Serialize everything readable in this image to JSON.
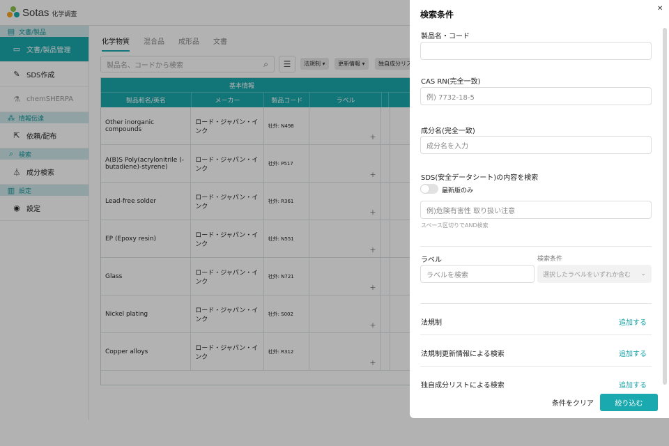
{
  "app": {
    "logo_text": "Sotas",
    "logo_sub": "化学調査",
    "colors": {
      "accent": "#1aa9ae",
      "accent_text": "#15a3a8",
      "section_bg": "#cfe9ea",
      "logo_green": "#8bc34a",
      "logo_orange": "#f5a623",
      "logo_teal": "#1aa9ae"
    }
  },
  "sidebar": {
    "sections": [
      {
        "label": "文書/製品",
        "icon": "document-icon",
        "items": [
          {
            "label": "文書/製品管理",
            "icon": "folder-icon",
            "active": true
          }
        ]
      },
      {
        "label": "",
        "items": [
          {
            "label": "SDS作成",
            "icon": "pencil-icon"
          },
          {
            "label": "chemSHERPA",
            "icon": "flask-icon",
            "disabled": true
          }
        ]
      },
      {
        "label": "情報伝達",
        "icon": "share-icon",
        "items": [
          {
            "label": "依頼/配布",
            "icon": "export-icon"
          }
        ]
      },
      {
        "label": "検索",
        "icon": "search-icon",
        "items": [
          {
            "label": "成分検索",
            "icon": "beaker-icon"
          }
        ]
      },
      {
        "label": "設定",
        "icon": "building-icon",
        "items": [
          {
            "label": "設定",
            "icon": "person-icon"
          }
        ]
      }
    ]
  },
  "main": {
    "tabs": [
      "化学物質",
      "混合品",
      "成形品",
      "文書"
    ],
    "search_placeholder": "製品名、コードから検索",
    "chips": [
      "法規制",
      "更新情報",
      "独自成分リス"
    ],
    "table": {
      "group_header": "基本情報",
      "columns": [
        "製品和名/英名",
        "メーカー",
        "製品コード",
        "ラベル"
      ],
      "rows": [
        {
          "name": "Other inorganic compounds",
          "maker": "ロード・ジャパン・インク",
          "code": "社外: N498"
        },
        {
          "name": "A(B)S Poly(acrylonitrile (-butadiene)-styrene)",
          "maker": "ロード・ジャパン・インク",
          "code": "社外: P517"
        },
        {
          "name": "Lead-free solder",
          "maker": "ロード・ジャパン・インク",
          "code": "社外: R361"
        },
        {
          "name": "EP (Epoxy resin)",
          "maker": "ロード・ジャパン・インク",
          "code": "社外: N551"
        },
        {
          "name": "Glass",
          "maker": "ロード・ジャパン・インク",
          "code": "社外: N721"
        },
        {
          "name": "Nickel plating",
          "maker": "ロード・ジャパン・インク",
          "code": "社外: S002"
        },
        {
          "name": "Copper alloys",
          "maker": "ロード・ジャパン・インク",
          "code": "社外: R312"
        }
      ]
    }
  },
  "drawer": {
    "title": "検索条件",
    "product_label": "製品名・コード",
    "product_value": "",
    "cas_label": "CAS RN(完全一致)",
    "cas_placeholder": "例) 7732-18-5",
    "component_label": "成分名(完全一致)",
    "component_placeholder": "成分名を入力",
    "sds_label": "SDS(安全データシート)の内容を検索",
    "latest_only_label": "最新版のみ",
    "sds_placeholder": "例)危険有害性 取り扱い注意",
    "sds_hint": "スペース区切りでAND検索",
    "label_label": "ラベル",
    "label_placeholder": "ラベルを検索",
    "condition_label": "検索条件",
    "condition_value": "選択したラベルをいずれか含む",
    "rows": [
      {
        "label": "法規制",
        "action": "追加する"
      },
      {
        "label": "法規制更新情報による検索",
        "action": "追加する"
      },
      {
        "label": "独自成分リストによる検索",
        "action": "追加する"
      }
    ],
    "clear_label": "条件をクリア",
    "apply_label": "絞り込む"
  }
}
